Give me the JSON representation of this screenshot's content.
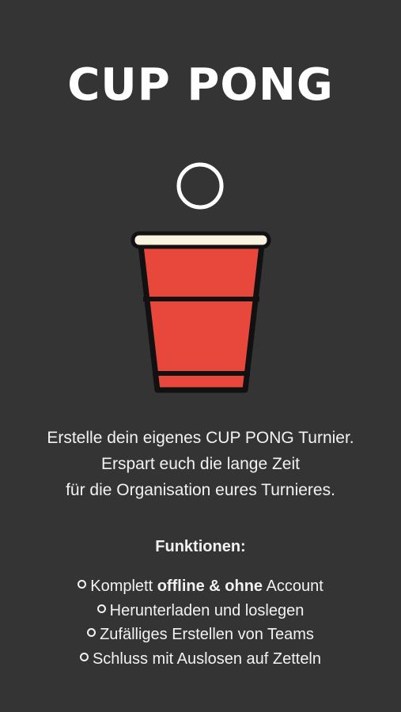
{
  "title": "CUP PONG",
  "description": [
    "Erstelle dein eigenes CUP PONG Turnier.",
    "Erspart euch die lange Zeit",
    "für die Organisation eures Turnieres."
  ],
  "features_heading": "Funktionen:",
  "features": {
    "f1": {
      "pre": "Komplett ",
      "bold": "offline & ohne",
      "post": " Account"
    },
    "f2": "Herunterladen und loslegen",
    "f3": "Zufälliges Erstellen von Teams",
    "f4": "Schluss mit Auslosen auf Zetteln"
  },
  "icons": {
    "ball": "ping-pong-ball-icon",
    "cup": "red-party-cup-icon"
  },
  "colors": {
    "background": "#343434",
    "cup_red": "#E8473B",
    "cup_rim": "#FAF3E0",
    "outline": "#111111",
    "text": "#FFFFFF"
  }
}
